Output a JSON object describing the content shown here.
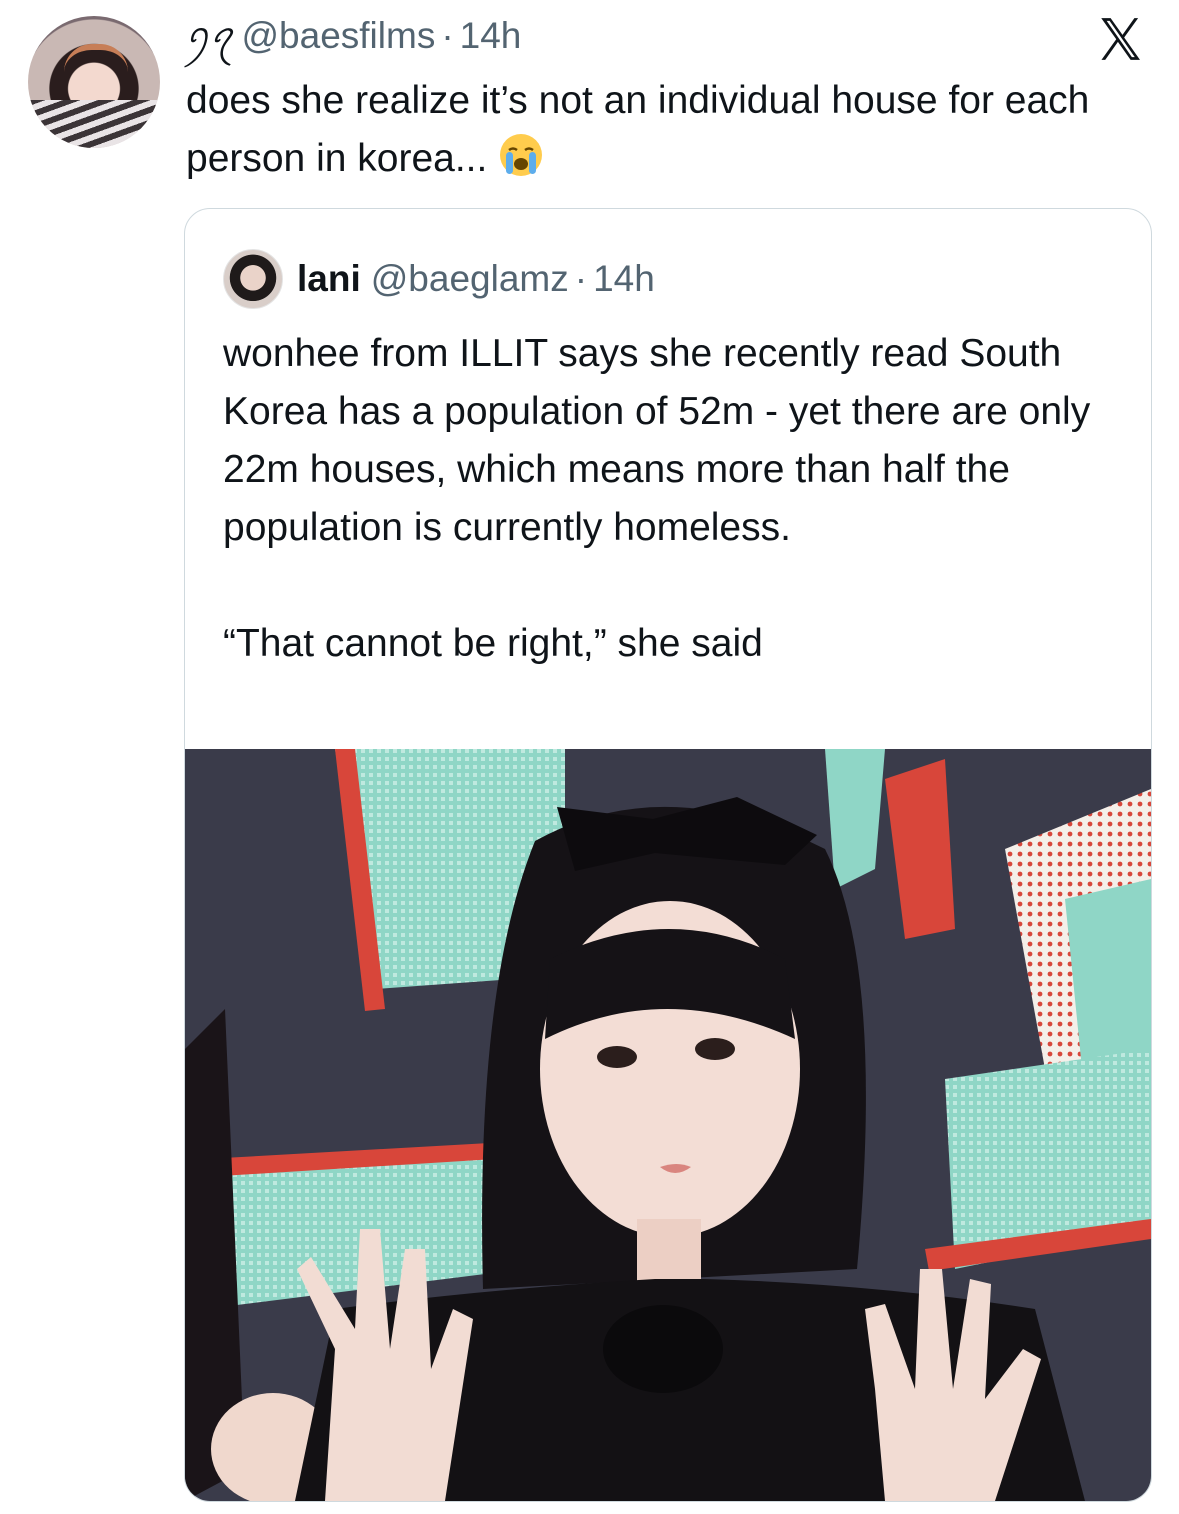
{
  "tweet": {
    "display_glyph": "ꪆꪖ",
    "handle": "@baesfilms",
    "separator": "·",
    "time": "14h",
    "text": "does she realize it’s not an individual house for each person in korea...",
    "emoji": "loudly-crying-face-emoji"
  },
  "brand": {
    "logo": "x-logo-icon"
  },
  "quoted": {
    "name": "lani",
    "handle": "@baeglamz",
    "separator": "·",
    "time": "14h",
    "paragraph1": "wonhee from ILLIT says she recently read South Korea has a population of 52m - yet there are only 22m houses, which means more than half the population is currently homeless.",
    "paragraph2": "“That cannot be right,” she said",
    "image": "photo-of-woman-with-black-bow-raising-hands"
  },
  "colors": {
    "text": "#0f1419",
    "muted": "#536471",
    "border": "#cfd9de",
    "photo_backdrop_navy": "#3a3b4a",
    "photo_backdrop_mint": "#8fd6c6",
    "photo_backdrop_red": "#d8463a"
  }
}
